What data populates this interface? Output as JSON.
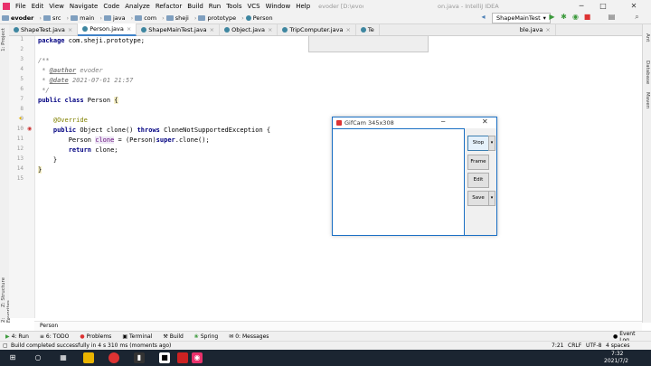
{
  "menubar": {
    "items": [
      "File",
      "Edit",
      "View",
      "Navigate",
      "Code",
      "Analyze",
      "Refactor",
      "Build",
      "Run",
      "Tools",
      "VCS",
      "Window",
      "Help"
    ],
    "title_left": "evoder [D:\\evod",
    "title_right": "on.java - IntelliJ IDEA"
  },
  "navbar": {
    "crumbs": [
      "evoder",
      "src",
      "main",
      "java",
      "com",
      "sheji",
      "prototype",
      "Person"
    ],
    "run_config": "ShapeMainTest"
  },
  "tabs": [
    {
      "label": "ShapeTest.java",
      "active": false
    },
    {
      "label": "Person.java",
      "active": true
    },
    {
      "label": "ShapeMainTest.java",
      "active": false
    },
    {
      "label": "Object.java",
      "active": false
    },
    {
      "label": "TripComputer.java",
      "active": false
    },
    {
      "label": "Te",
      "active": false
    },
    {
      "label": "ble.java",
      "active": false
    }
  ],
  "left_strip": {
    "project": "1: Project",
    "structure": "Z: Structure",
    "favorites": "2: Favorites"
  },
  "right_strip": {
    "ant": "Ant",
    "database": "Database",
    "maven": "Maven"
  },
  "code": {
    "line_numbers": [
      "1",
      "2",
      "3",
      "4",
      "5",
      "6",
      "7",
      "8",
      "9",
      "10",
      "11",
      "12",
      "13",
      "14",
      "15"
    ],
    "package_kw": "package",
    "package_name": " com.sheji.prototype;",
    "doc_open": "/**",
    "author_tag": "@author",
    "author_val": " evoder",
    "date_tag": "@date",
    "date_val": " 2021-07-01 21:57",
    "doc_close": "*/",
    "class_kw": "public class",
    "class_name": " Person ",
    "brace_open": "{",
    "override": "@Override",
    "method_public": "public",
    "method_sig": " Object clone() ",
    "throws_kw": "throws",
    "method_exc": " CloneNotSupportedException {",
    "decl_type": "Person ",
    "decl_var": "clone",
    "decl_rest": " = (Person)",
    "super_kw": "super",
    "decl_end": ".clone();",
    "return_kw": "return",
    "return_rest": " clone;",
    "close_method": "}",
    "close_class": "}"
  },
  "editor_breadcrumb": "Person",
  "tool_windows": [
    {
      "icon": "run-icon",
      "glyph": "▶",
      "label": "4: Run"
    },
    {
      "icon": "todo-icon",
      "glyph": "≡",
      "label": "6: TODO"
    },
    {
      "icon": "problems-icon",
      "glyph": "●",
      "label": "Problems"
    },
    {
      "icon": "terminal-icon",
      "glyph": "▣",
      "label": "Terminal"
    },
    {
      "icon": "build-icon",
      "glyph": "⚒",
      "label": "Build"
    },
    {
      "icon": "spring-icon",
      "glyph": "❀",
      "label": "Spring"
    },
    {
      "icon": "messages-icon",
      "glyph": "✉",
      "label": "0: Messages"
    }
  ],
  "event_log": "Event Log",
  "status": {
    "message": "Build completed successfully in 4 s 310 ms (moments ago)",
    "position": "7:21",
    "line_sep": "CRLF",
    "encoding": "UTF-8",
    "indent": "4 spaces"
  },
  "taskbar": {
    "time": "7:32",
    "date": "2021/7/2"
  },
  "gifcam": {
    "title": "GifCam 345x308",
    "buttons": {
      "stop": "Stop",
      "frame": "Frame",
      "edit": "Edit",
      "save": "Save"
    }
  },
  "colors": {
    "accent": "#4083c9",
    "gifcam_border": "#1a6fc4",
    "keyword": "#000080"
  }
}
